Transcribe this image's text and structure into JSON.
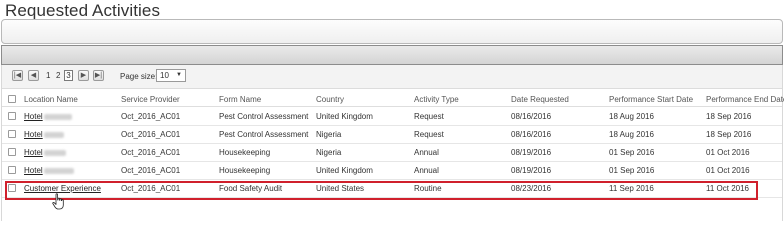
{
  "page": {
    "title": "Requested Activities"
  },
  "pager": {
    "pages": [
      "1",
      "2",
      "3"
    ],
    "current_page": "3",
    "page_size_label": "Page size:",
    "page_size_value": "10",
    "icons": {
      "first": "first-page-icon",
      "prev": "prev-page-icon",
      "next": "next-page-icon",
      "last": "last-page-icon"
    }
  },
  "table": {
    "columns": [
      "Location Name",
      "Service Provider",
      "Form Name",
      "Country",
      "Activity Type",
      "Date Requested",
      "Performance Start Date",
      "Performance End Date"
    ],
    "rows": [
      {
        "location": "Hotel",
        "provider": "Oct_2016_AC01",
        "form": "Pest Control Assessment",
        "country": "United Kingdom",
        "type": "Request",
        "requested": "08/16/2016",
        "start": "18 Aug 2016",
        "end": "18 Sep 2016"
      },
      {
        "location": "Hotel",
        "provider": "Oct_2016_AC01",
        "form": "Pest Control Assessment",
        "country": "Nigeria",
        "type": "Request",
        "requested": "08/16/2016",
        "start": "18 Aug 2016",
        "end": "18 Sep 2016"
      },
      {
        "location": "Hotel",
        "provider": "Oct_2016_AC01",
        "form": "Housekeeping",
        "country": "Nigeria",
        "type": "Annual",
        "requested": "08/19/2016",
        "start": "01 Sep 2016",
        "end": "01 Oct 2016"
      },
      {
        "location": "Hotel",
        "provider": "Oct_2016_AC01",
        "form": "Housekeeping",
        "country": "United Kingdom",
        "type": "Annual",
        "requested": "08/19/2016",
        "start": "01 Sep 2016",
        "end": "01 Oct 2016"
      },
      {
        "location": "Customer Experience",
        "provider": "Oct_2016_AC01",
        "form": "Food Safety Audit",
        "country": "United States",
        "type": "Routine",
        "requested": "08/23/2016",
        "start": "11 Sep 2016",
        "end": "11 Oct 2016"
      }
    ]
  },
  "colors": {
    "highlight": "#d0202c"
  }
}
